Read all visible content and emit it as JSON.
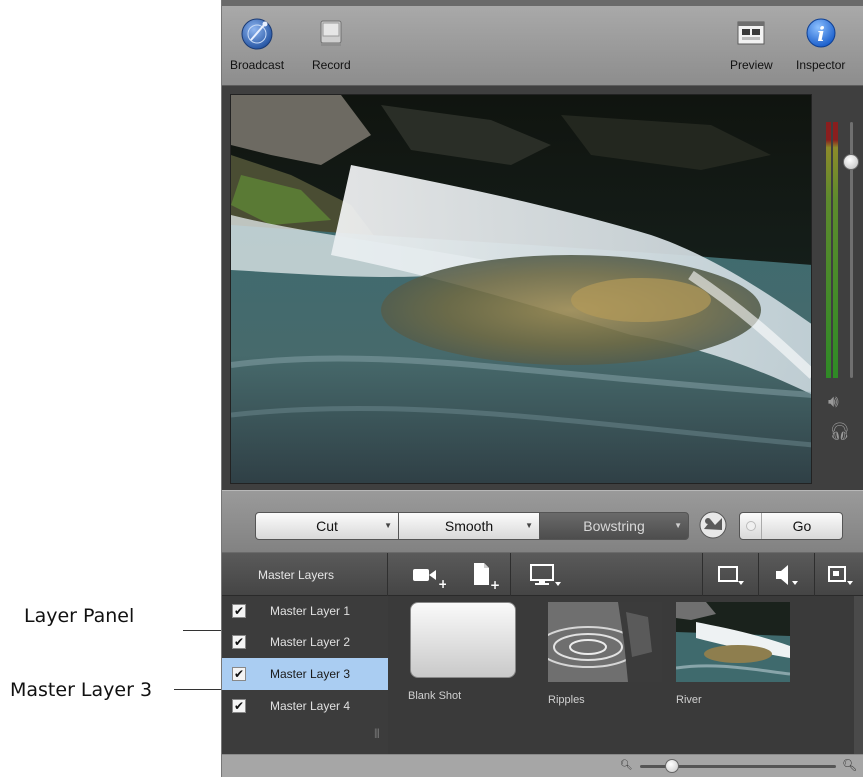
{
  "callouts": {
    "layer_panel": "Layer Panel",
    "master_layer_3": "Master Layer 3"
  },
  "toolbar": {
    "broadcast": "Broadcast",
    "record": "Record",
    "preview": "Preview",
    "inspector": "Inspector"
  },
  "transitions": {
    "cut": "Cut",
    "smooth": "Smooth",
    "bowstring": "Bowstring",
    "go": "Go"
  },
  "layers": {
    "header": "Master Layers",
    "items": [
      {
        "label": "Master Layer 1",
        "checked": true,
        "selected": false
      },
      {
        "label": "Master Layer 2",
        "checked": true,
        "selected": false
      },
      {
        "label": "Master Layer 3",
        "checked": true,
        "selected": true
      },
      {
        "label": "Master Layer 4",
        "checked": true,
        "selected": false
      }
    ]
  },
  "shots": [
    {
      "name": "Blank Shot",
      "icon": "blank-shot-thumbnail"
    },
    {
      "name": "Ripples",
      "icon": "ripples-thumbnail"
    },
    {
      "name": "River",
      "icon": "river-thumbnail"
    }
  ],
  "colors": {
    "selected_row": "#aacdf2",
    "toolbar": "#9a9a9a",
    "panel": "#3a3a3a"
  }
}
